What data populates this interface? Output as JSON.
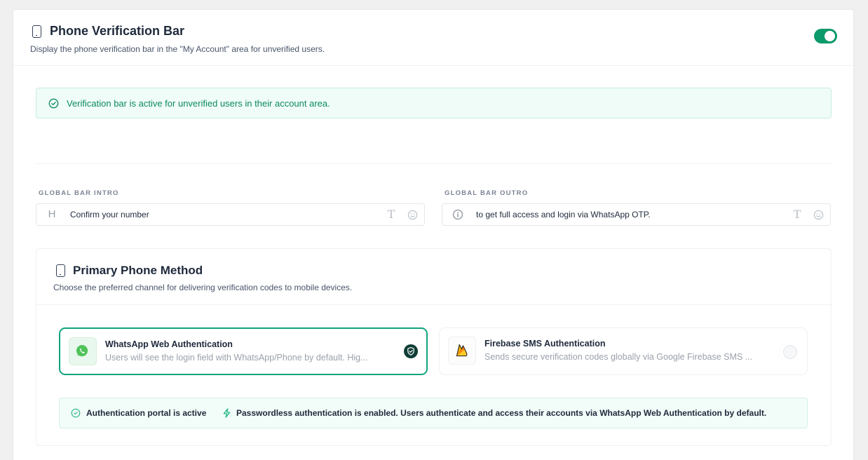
{
  "header": {
    "title": "Phone Verification Bar",
    "subtitle": "Display the phone verification bar in the \"My Account\" area for unverified users.",
    "toggle_on": true
  },
  "notice": {
    "text": "Verification bar is active for unverified users in their account area."
  },
  "fields": {
    "intro": {
      "label": "GLOBAL BAR INTRO",
      "value": "Confirm your number",
      "lead_icon": "H"
    },
    "outro": {
      "label": "GLOBAL BAR OUTRO",
      "value": "to get full access and login via WhatsApp OTP.",
      "lead_icon": "info-icon"
    }
  },
  "method": {
    "title": "Primary Phone Method",
    "subtitle": "Choose the preferred channel for delivering verification codes to mobile devices.",
    "options": [
      {
        "title": "WhatsApp Web Authentication",
        "description": "Users will see the login field with WhatsApp/Phone by default. Hig...",
        "selected": true,
        "icon": "whatsapp-icon"
      },
      {
        "title": "Firebase SMS Authentication",
        "description": "Sends secure verification codes globally via Google Firebase SMS ...",
        "selected": false,
        "icon": "firebase-icon"
      }
    ],
    "status": {
      "portal": "Authentication portal is active",
      "message": "Passwordless authentication is enabled. Users authenticate and access their accounts via WhatsApp Web Authentication by default."
    }
  },
  "colors": {
    "accent": "#10a37f",
    "toggle": "#0c9a6c",
    "notice_text": "#0b8a5e"
  }
}
